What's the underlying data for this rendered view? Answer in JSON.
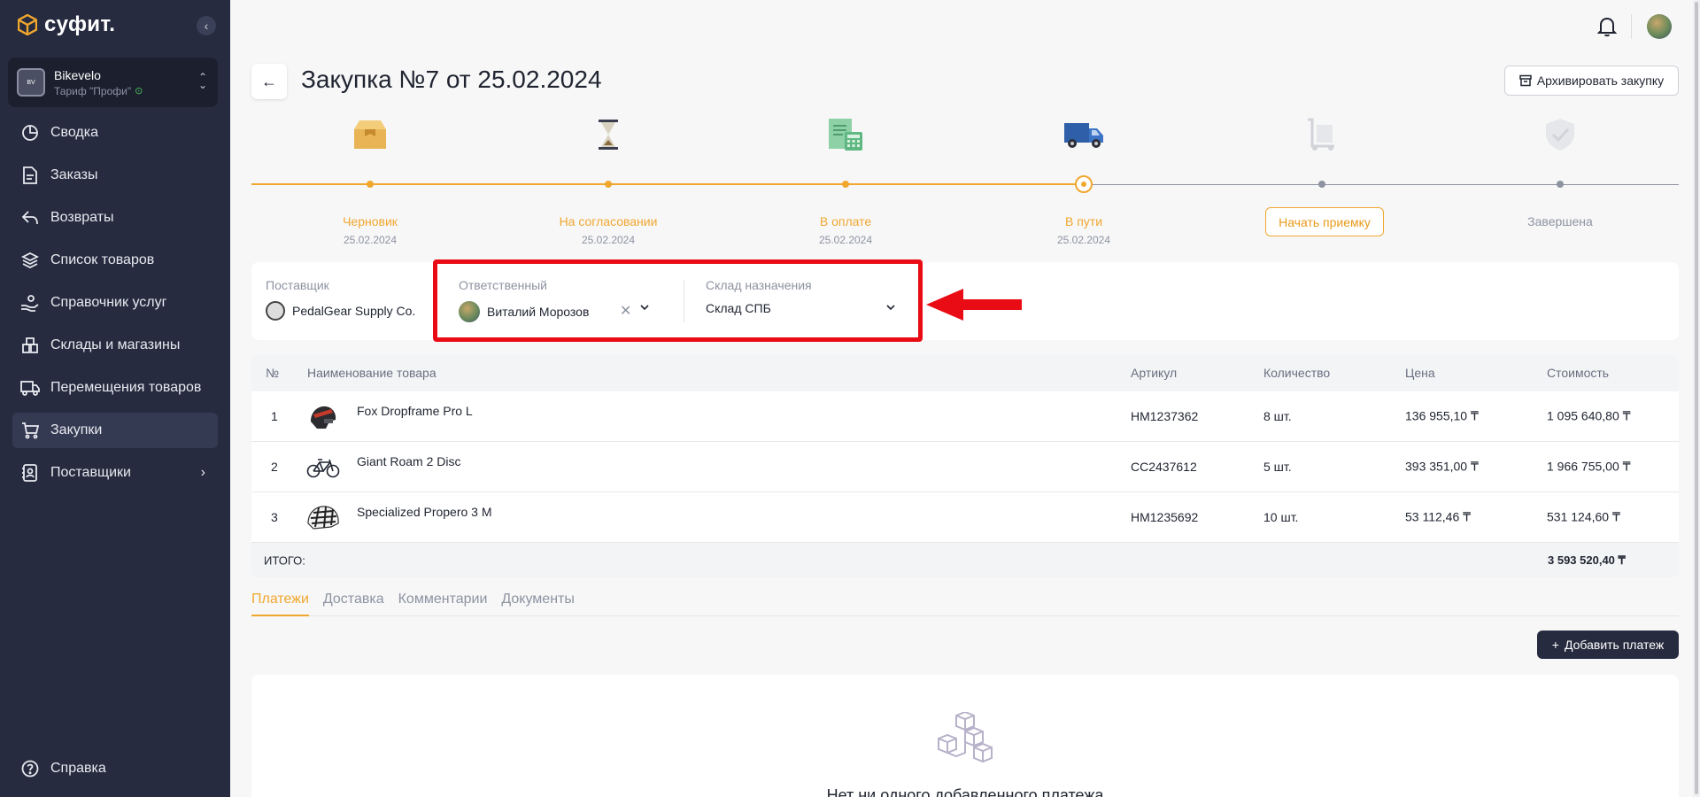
{
  "brand": {
    "name": "суфит.",
    "accent": "#f0a72e"
  },
  "company": {
    "name": "Bikevelo",
    "plan": "Тариф \"Профи\""
  },
  "nav": [
    {
      "label": "Сводка",
      "icon": "pie-chart-icon"
    },
    {
      "label": "Заказы",
      "icon": "document-icon"
    },
    {
      "label": "Возвраты",
      "icon": "return-arrow-icon"
    },
    {
      "label": "Список товаров",
      "icon": "layers-icon"
    },
    {
      "label": "Справочник услуг",
      "icon": "hand-service-icon"
    },
    {
      "label": "Склады и магазины",
      "icon": "warehouse-icon"
    },
    {
      "label": "Перемещения товаров",
      "icon": "truck-icon"
    },
    {
      "label": "Закупки",
      "icon": "cart-icon",
      "active": true
    },
    {
      "label": "Поставщики",
      "icon": "contacts-icon",
      "has_submenu": true
    }
  ],
  "help": {
    "label": "Справка"
  },
  "page": {
    "title": "Закупка №7 от 25.02.2024",
    "archive_label": "Архивировать закупку"
  },
  "statuses": [
    {
      "label": "Черновик",
      "date": "25.02.2024",
      "state": "done"
    },
    {
      "label": "На согласовании",
      "date": "25.02.2024",
      "state": "done"
    },
    {
      "label": "В оплате",
      "date": "25.02.2024",
      "state": "done"
    },
    {
      "label": "В пути",
      "date": "25.02.2024",
      "state": "current"
    },
    {
      "action_label": "Начать приемку",
      "state": "pending"
    },
    {
      "label": "Завершена",
      "state": "pending"
    }
  ],
  "info": {
    "supplier_label": "Поставщик",
    "supplier_value": "PedalGear Supply Co.",
    "responsible_label": "Ответственный",
    "responsible_value": "Виталий Морозов",
    "warehouse_label": "Склад назначения",
    "warehouse_value": "Склад СПБ"
  },
  "table": {
    "headers": [
      "№",
      "Наименование товара",
      "Артикул",
      "Количество",
      "Цена",
      "Стоимость"
    ],
    "rows": [
      {
        "num": "1",
        "name": "Fox Dropframe Pro L",
        "sku": "HM1237362",
        "qty": "8 шт.",
        "price": "136 955,10 ₸",
        "cost": "1 095 640,80 ₸",
        "thumb": "helmet-dark"
      },
      {
        "num": "2",
        "name": "Giant Roam 2 Disc",
        "sku": "CC2437612",
        "qty": "5 шт.",
        "price": "393 351,00 ₸",
        "cost": "1 966 755,00 ₸",
        "thumb": "bicycle"
      },
      {
        "num": "3",
        "name": "Specialized Propero 3 M",
        "sku": "HM1235692",
        "qty": "10 шт.",
        "price": "53 112,46 ₸",
        "cost": "531 124,60 ₸",
        "thumb": "helmet-white"
      }
    ],
    "total_label": "ИТОГО:",
    "total_value": "3 593 520,40 ₸"
  },
  "tabs": [
    "Платежи",
    "Доставка",
    "Комментарии",
    "Документы"
  ],
  "payments": {
    "add_label": "Добавить платеж",
    "empty_text": "Нет ни одного добавленного платежа"
  }
}
